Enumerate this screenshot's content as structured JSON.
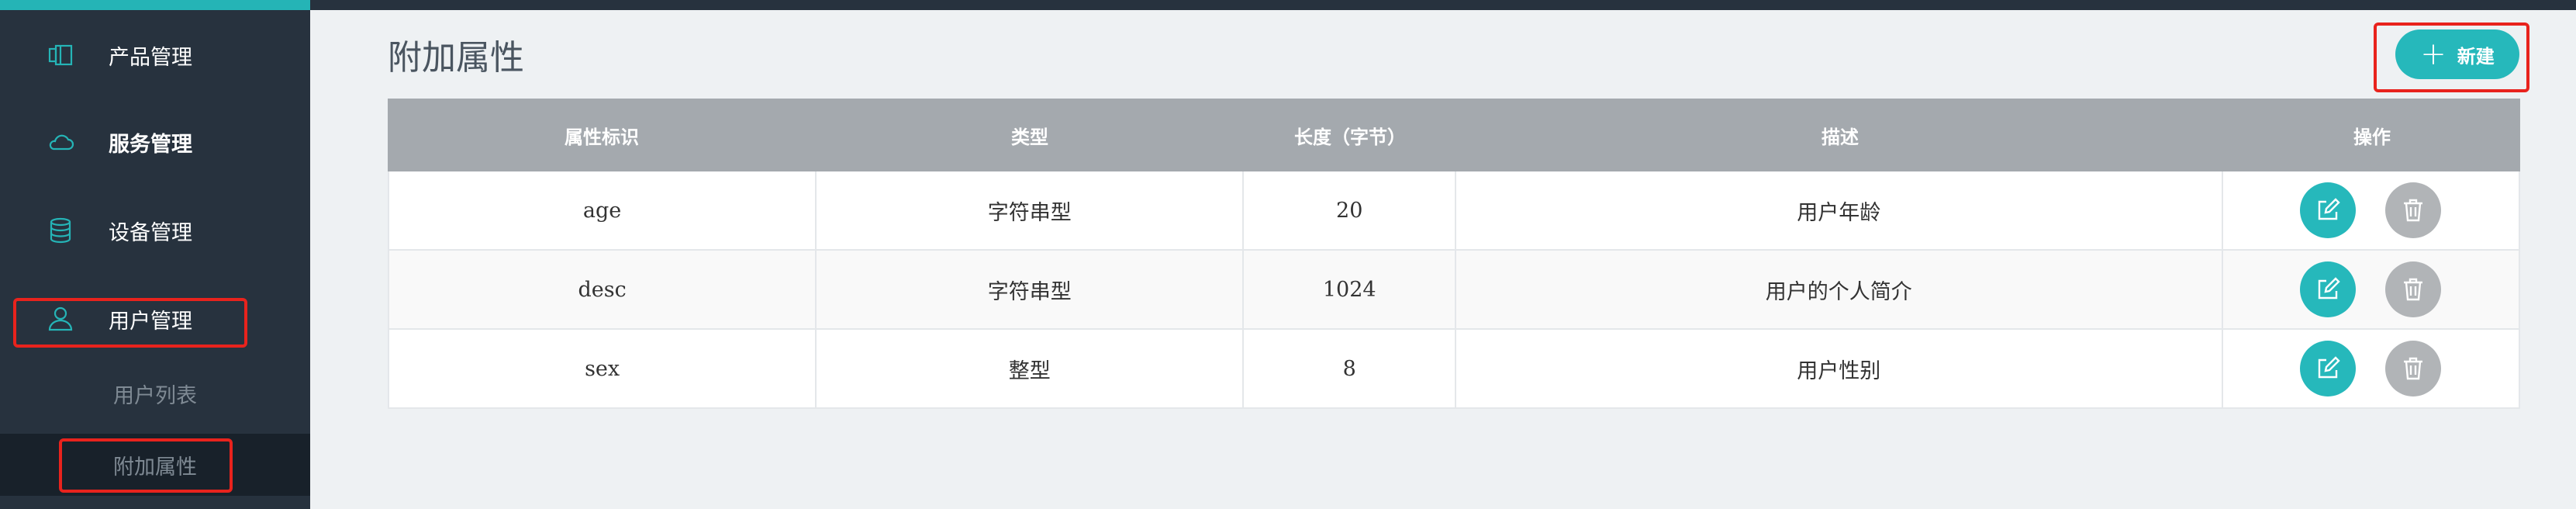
{
  "sidebar": {
    "items": [
      {
        "label": "产品管理",
        "icon": "product-icon"
      },
      {
        "label": "服务管理",
        "icon": "cloud-icon"
      },
      {
        "label": "设备管理",
        "icon": "database-icon"
      },
      {
        "label": "用户管理",
        "icon": "user-icon"
      }
    ],
    "sub_items": [
      {
        "label": "用户列表"
      },
      {
        "label": "附加属性"
      }
    ]
  },
  "header": {
    "title": "附加属性",
    "new_button": "新建"
  },
  "table": {
    "columns": [
      "属性标识",
      "类型",
      "长度（字节）",
      "描述",
      "操作"
    ],
    "rows": [
      {
        "id": "age",
        "type": "字符串型",
        "length": "20",
        "desc": "用户年龄"
      },
      {
        "id": "desc",
        "type": "字符串型",
        "length": "1024",
        "desc": "用户的个人简介"
      },
      {
        "id": "sex",
        "type": "整型",
        "length": "8",
        "desc": "用户性别"
      }
    ]
  },
  "colors": {
    "accent": "#26b8bb",
    "sidebar_bg": "#27323e",
    "header_bg": "#a4a9ae",
    "highlight": "#e8231d"
  }
}
